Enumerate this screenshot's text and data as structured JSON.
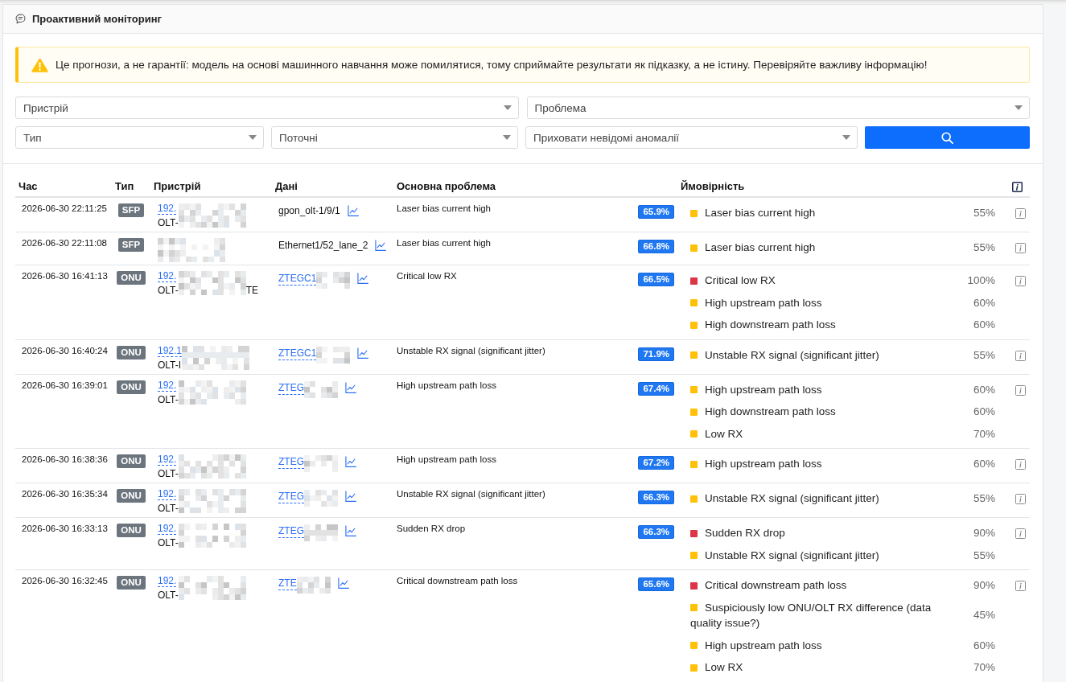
{
  "panel": {
    "title": "Проактивний моніторинг"
  },
  "warning": {
    "text": "Це прогнози, а не гарантії: модель на основі машинного навчання може помилятися, тому сприймайте результати як підказку, а не істину. Перевіряйте важливу інформацію!"
  },
  "filter_rows": [
    [
      {
        "value": "Пристрій"
      },
      {
        "value": "Проблема"
      }
    ],
    [
      {
        "value": "Тип"
      },
      {
        "value": "Поточні"
      },
      {
        "value": "Приховати невідомі аномалії"
      }
    ]
  ],
  "table": {
    "columns": [
      "Час",
      "Тип",
      "Пристрій",
      "Дані",
      "Основна проблема",
      "Ймовірність"
    ],
    "rows": [
      {
        "time": "2026-06-30 22:11:25",
        "type": "SFP",
        "device": {
          "ip": "192.",
          "name": "OLT-"
        },
        "data": {
          "kind": "text",
          "text": "gpon_olt-1/9/1"
        },
        "problem": "Laser bias current high",
        "score": "65.9%",
        "probabilities": [
          {
            "label": "Laser bias current high",
            "value": "55%",
            "color": "#ffc107"
          }
        ]
      },
      {
        "time": "2026-06-30 22:11:08",
        "type": "SFP",
        "data": {
          "kind": "text",
          "text": "Ethernet1/52_lane_2"
        },
        "problem": "Laser bias current high",
        "score": "66.8%",
        "probabilities": [
          {
            "label": "Laser bias current high",
            "value": "55%",
            "color": "#ffc107"
          }
        ]
      },
      {
        "time": "2026-06-30 16:41:13",
        "type": "ONU",
        "device": {
          "ip": "192.",
          "name": "OLT-",
          "name_end": "TE"
        },
        "data": {
          "kind": "link",
          "text": "ZTEGC1"
        },
        "problem": "Critical low RX",
        "score": "66.5%",
        "probabilities": [
          {
            "label": "Critical low RX",
            "value": "100%",
            "color": "#dc3545"
          },
          {
            "label": "High upstream path loss",
            "value": "60%",
            "color": "#ffc107"
          },
          {
            "label": "High downstream path loss",
            "value": "60%",
            "color": "#ffc107"
          }
        ]
      },
      {
        "time": "2026-06-30 16:40:24",
        "type": "ONU",
        "device": {
          "ip": "192.1",
          "name": "OLT-I"
        },
        "data": {
          "kind": "link",
          "text": "ZTEGC1"
        },
        "problem": "Unstable RX signal (significant jitter)",
        "score": "71.9%",
        "probabilities": [
          {
            "label": "Unstable RX signal (significant jitter)",
            "value": "55%",
            "color": "#ffc107"
          }
        ]
      },
      {
        "time": "2026-06-30 16:39:01",
        "type": "ONU",
        "device": {
          "ip": "192.",
          "name": "OLT-"
        },
        "data": {
          "kind": "link",
          "text": "ZTEG"
        },
        "problem": "High upstream path loss",
        "score": "67.4%",
        "probabilities": [
          {
            "label": "High upstream path loss",
            "value": "60%",
            "color": "#ffc107"
          },
          {
            "label": "High downstream path loss",
            "value": "60%",
            "color": "#ffc107"
          },
          {
            "label": "Low RX",
            "value": "70%",
            "color": "#ffc107"
          }
        ]
      },
      {
        "time": "2026-06-30 16:38:36",
        "type": "ONU",
        "device": {
          "ip": "192.",
          "name": "OLT-"
        },
        "data": {
          "kind": "link",
          "text": "ZTEG"
        },
        "problem": "High upstream path loss",
        "score": "67.2%",
        "probabilities": [
          {
            "label": "High upstream path loss",
            "value": "60%",
            "color": "#ffc107"
          }
        ]
      },
      {
        "time": "2026-06-30 16:35:34",
        "type": "ONU",
        "device": {
          "ip": "192.",
          "name": "OLT-"
        },
        "data": {
          "kind": "link",
          "text": "ZTEG"
        },
        "problem": "Unstable RX signal (significant jitter)",
        "score": "66.3%",
        "probabilities": [
          {
            "label": "Unstable RX signal (significant jitter)",
            "value": "55%",
            "color": "#ffc107"
          }
        ]
      },
      {
        "time": "2026-06-30 16:33:13",
        "type": "ONU",
        "device": {
          "ip": "192.",
          "name": "OLT-"
        },
        "data": {
          "kind": "link",
          "text": "ZTEG"
        },
        "problem": "Sudden RX drop",
        "score": "66.3%",
        "probabilities": [
          {
            "label": "Sudden RX drop",
            "value": "90%",
            "color": "#dc3545"
          },
          {
            "label": "Unstable RX signal (significant jitter)",
            "value": "55%",
            "color": "#ffc107"
          }
        ]
      },
      {
        "time": "2026-06-30 16:32:45",
        "type": "ONU",
        "device": {
          "ip": "192.",
          "name": "OLT-"
        },
        "data": {
          "kind": "link",
          "text": "ZTE"
        },
        "problem": "Critical downstream path loss",
        "score": "65.6%",
        "probabilities": [
          {
            "label": "Critical downstream path loss",
            "value": "90%",
            "color": "#dc3545"
          },
          {
            "label": "Suspiciously low ONU/OLT RX difference (data quality issue?)",
            "value": "45%",
            "color": "#ffc107"
          },
          {
            "label": "High upstream path loss",
            "value": "60%",
            "color": "#ffc107"
          },
          {
            "label": "Low RX",
            "value": "70%",
            "color": "#ffc107"
          }
        ]
      }
    ]
  }
}
